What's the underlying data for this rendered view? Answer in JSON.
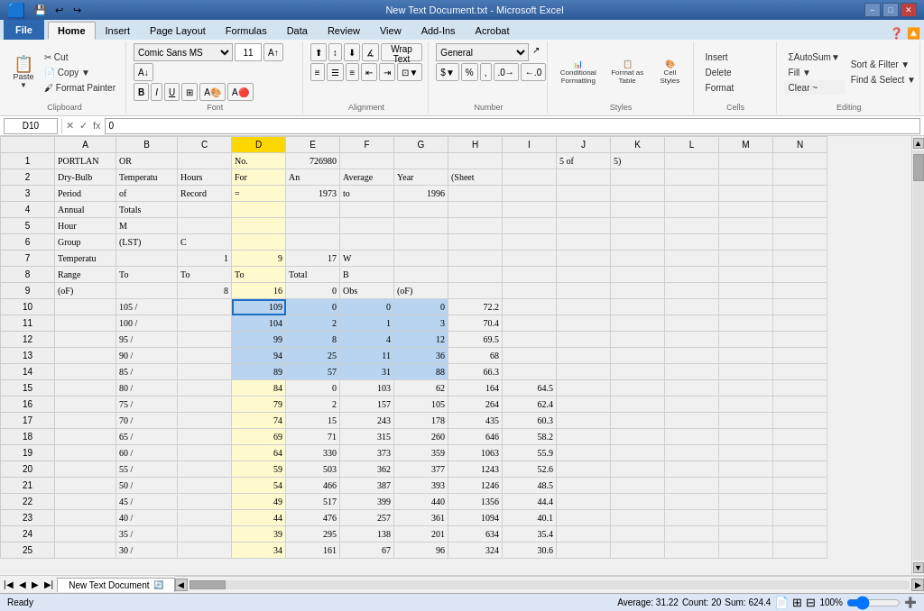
{
  "titleBar": {
    "title": "New Text Document.txt - Microsoft Excel",
    "minimizeLabel": "−",
    "maximizeLabel": "□",
    "closeLabel": "✕"
  },
  "ribbonTabs": [
    "File",
    "Home",
    "Insert",
    "Page Layout",
    "Formulas",
    "Data",
    "Review",
    "View",
    "Add-Ins",
    "Acrobat"
  ],
  "activeTab": "Home",
  "toolbar": {
    "paste": "Paste",
    "clipboard": "Clipboard",
    "fontName": "Comic Sans MS",
    "fontSize": "11",
    "bold": "B",
    "italic": "I",
    "underline": "U",
    "fontGroup": "Font",
    "wrapText": "Wrap Text",
    "mergeCenterLabel": "Merge & Center",
    "alignmentGroup": "Alignment",
    "generalLabel": "General",
    "dollarLabel": "$",
    "percentLabel": "%",
    "commaLabel": ",",
    "decInc": ".0",
    "decDec": ".00",
    "numberGroup": "Number",
    "conditionalFormat": "Conditional Formatting",
    "formatTable": "Format as Table",
    "cellStyles": "Cell Styles",
    "stylesGroup": "Styles",
    "insertBtn": "Insert",
    "deleteBtn": "Delete",
    "formatBtn": "Format",
    "cellsGroup": "Cells",
    "autosum": "AutoSum",
    "fill": "Fill",
    "clear": "Clear ~",
    "sortFilter": "Sort & Filter",
    "findSelect": "Find & Select",
    "editingGroup": "Editing"
  },
  "formulaBar": {
    "cellRef": "D10",
    "formula": "0"
  },
  "columns": [
    "",
    "A",
    "B",
    "C",
    "D",
    "E",
    "F",
    "G",
    "H",
    "I",
    "J",
    "K",
    "L",
    "M",
    "N"
  ],
  "rows": [
    {
      "num": 1,
      "A": "PORTLAN",
      "B": "OR",
      "C": "",
      "D": "No.",
      "E": "726980",
      "F": "",
      "G": "",
      "H": "",
      "I": "",
      "J": "5 of",
      "K": "5)",
      "L": "",
      "M": "",
      "N": ""
    },
    {
      "num": 2,
      "A": "Dry-Bulb",
      "B": "Temperatu",
      "C": "Hours",
      "D": "For",
      "E": "An",
      "F": "Average",
      "G": "Year",
      "H": "(Sheet",
      "I": "",
      "J": "",
      "K": "",
      "L": "",
      "M": "",
      "N": ""
    },
    {
      "num": 3,
      "A": "Period",
      "B": "of",
      "C": "Record",
      "D": "=",
      "E": "1973",
      "F": "to",
      "G": "1996",
      "H": "",
      "I": "",
      "J": "",
      "K": "",
      "L": "",
      "M": "",
      "N": ""
    },
    {
      "num": 4,
      "A": "Annual",
      "B": "Totals",
      "C": "",
      "D": "",
      "E": "",
      "F": "",
      "G": "",
      "H": "",
      "I": "",
      "J": "",
      "K": "",
      "L": "",
      "M": "",
      "N": ""
    },
    {
      "num": 5,
      "A": "Hour",
      "B": "M",
      "C": "",
      "D": "",
      "E": "",
      "F": "",
      "G": "",
      "H": "",
      "I": "",
      "J": "",
      "K": "",
      "L": "",
      "M": "",
      "N": ""
    },
    {
      "num": 6,
      "A": "Group",
      "B": "(LST)",
      "C": "C",
      "D": "",
      "E": "",
      "F": "",
      "G": "",
      "H": "",
      "I": "",
      "J": "",
      "K": "",
      "L": "",
      "M": "",
      "N": ""
    },
    {
      "num": 7,
      "A": "Temperatu",
      "B": "",
      "C": "1",
      "D": "9",
      "E": "17",
      "F": "W",
      "G": "",
      "H": "",
      "I": "",
      "J": "",
      "K": "",
      "L": "",
      "M": "",
      "N": ""
    },
    {
      "num": 8,
      "A": "Range",
      "B": "To",
      "C": "To",
      "D": "To",
      "E": "Total",
      "F": "B",
      "G": "",
      "H": "",
      "I": "",
      "J": "",
      "K": "",
      "L": "",
      "M": "",
      "N": ""
    },
    {
      "num": 9,
      "A": "(oF)",
      "B": "",
      "C": "8",
      "D": "16",
      "E": "0",
      "F": "Obs",
      "G": "(oF)",
      "H": "",
      "I": "",
      "J": "",
      "K": "",
      "L": "",
      "M": "",
      "N": ""
    },
    {
      "num": 10,
      "A": "",
      "B": "105 /",
      "C": "",
      "D": "109",
      "E": "0",
      "F": "0",
      "G": "0",
      "H": "72.2",
      "I": "",
      "J": "",
      "K": "",
      "L": "",
      "M": "",
      "N": "",
      "highlight": true,
      "active": true
    },
    {
      "num": 11,
      "A": "",
      "B": "100 /",
      "C": "",
      "D": "104",
      "E": "2",
      "F": "1",
      "G": "3",
      "H": "70.4",
      "I": "",
      "J": "",
      "K": "",
      "L": "",
      "M": "",
      "N": "",
      "highlight": true
    },
    {
      "num": 12,
      "A": "",
      "B": "95 /",
      "C": "",
      "D": "99",
      "E": "8",
      "F": "4",
      "G": "12",
      "H": "69.5",
      "I": "",
      "J": "",
      "K": "",
      "L": "",
      "M": "",
      "N": "",
      "highlight": true
    },
    {
      "num": 13,
      "A": "",
      "B": "90 /",
      "C": "",
      "D": "94",
      "E": "25",
      "F": "11",
      "G": "36",
      "H": "68",
      "I": "",
      "J": "",
      "K": "",
      "L": "",
      "M": "",
      "N": "",
      "highlight": true
    },
    {
      "num": 14,
      "A": "",
      "B": "85 /",
      "C": "",
      "D": "89",
      "E": "57",
      "F": "31",
      "G": "88",
      "H": "66.3",
      "I": "",
      "J": "",
      "K": "",
      "L": "",
      "M": "",
      "N": "",
      "highlight": true
    },
    {
      "num": 15,
      "A": "",
      "B": "80 /",
      "C": "",
      "D": "84",
      "E": "0",
      "F": "103",
      "G": "62",
      "H": "164",
      "I": "64.5",
      "J": "",
      "K": "",
      "L": "",
      "M": "",
      "N": ""
    },
    {
      "num": 16,
      "A": "",
      "B": "75 /",
      "C": "",
      "D": "79",
      "E": "2",
      "F": "157",
      "G": "105",
      "H": "264",
      "I": "62.4",
      "J": "",
      "K": "",
      "L": "",
      "M": "",
      "N": ""
    },
    {
      "num": 17,
      "A": "",
      "B": "70 /",
      "C": "",
      "D": "74",
      "E": "15",
      "F": "243",
      "G": "178",
      "H": "435",
      "I": "60.3",
      "J": "",
      "K": "",
      "L": "",
      "M": "",
      "N": ""
    },
    {
      "num": 18,
      "A": "",
      "B": "65 /",
      "C": "",
      "D": "69",
      "E": "71",
      "F": "315",
      "G": "260",
      "H": "646",
      "I": "58.2",
      "J": "",
      "K": "",
      "L": "",
      "M": "",
      "N": ""
    },
    {
      "num": 19,
      "A": "",
      "B": "60 /",
      "C": "",
      "D": "64",
      "E": "330",
      "F": "373",
      "G": "359",
      "H": "1063",
      "I": "55.9",
      "J": "",
      "K": "",
      "L": "",
      "M": "",
      "N": ""
    },
    {
      "num": 20,
      "A": "",
      "B": "55 /",
      "C": "",
      "D": "59",
      "E": "503",
      "F": "362",
      "G": "377",
      "H": "1243",
      "I": "52.6",
      "J": "",
      "K": "",
      "L": "",
      "M": "",
      "N": ""
    },
    {
      "num": 21,
      "A": "",
      "B": "50 /",
      "C": "",
      "D": "54",
      "E": "466",
      "F": "387",
      "G": "393",
      "H": "1246",
      "I": "48.5",
      "J": "",
      "K": "",
      "L": "",
      "M": "",
      "N": ""
    },
    {
      "num": 22,
      "A": "",
      "B": "45 /",
      "C": "",
      "D": "49",
      "E": "517",
      "F": "399",
      "G": "440",
      "H": "1356",
      "I": "44.4",
      "J": "",
      "K": "",
      "L": "",
      "M": "",
      "N": ""
    },
    {
      "num": 23,
      "A": "",
      "B": "40 /",
      "C": "",
      "D": "44",
      "E": "476",
      "F": "257",
      "G": "361",
      "H": "1094",
      "I": "40.1",
      "J": "",
      "K": "",
      "L": "",
      "M": "",
      "N": ""
    },
    {
      "num": 24,
      "A": "",
      "B": "35 /",
      "C": "",
      "D": "39",
      "E": "295",
      "F": "138",
      "G": "201",
      "H": "634",
      "I": "35.4",
      "J": "",
      "K": "",
      "L": "",
      "M": "",
      "N": ""
    },
    {
      "num": 25,
      "A": "",
      "B": "30 /",
      "C": "",
      "D": "34",
      "E": "161",
      "F": "67",
      "G": "96",
      "H": "324",
      "I": "30.6",
      "J": "",
      "K": "",
      "L": "",
      "M": "",
      "N": ""
    }
  ],
  "sheetTabs": [
    "New Text Document"
  ],
  "statusBar": {
    "ready": "Ready",
    "average": "Average: 31.22",
    "count": "Count: 20",
    "sum": "Sum: 624.4",
    "zoom": "100%"
  }
}
